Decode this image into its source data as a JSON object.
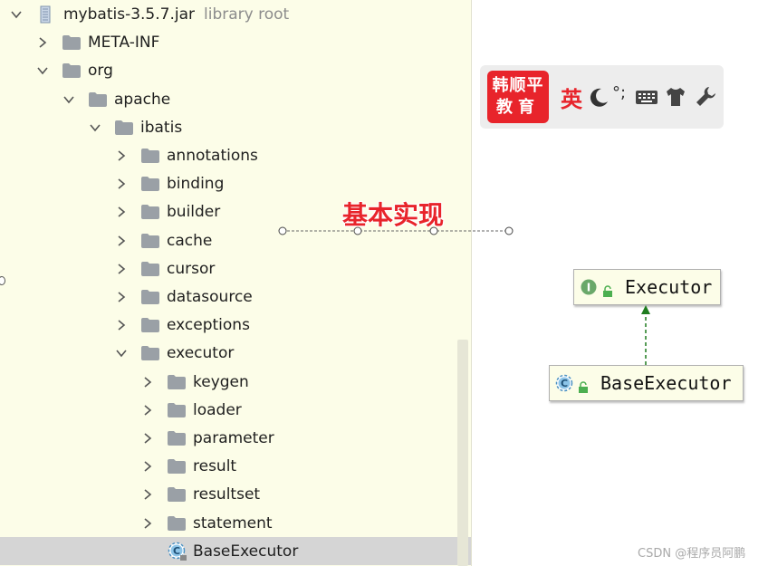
{
  "tree": {
    "root": {
      "name": "mybatis-3.5.7.jar",
      "note": "library root"
    },
    "items": [
      {
        "label": "META-INF",
        "state": "collapsed"
      },
      {
        "label": "org",
        "state": "expanded"
      },
      {
        "label": "apache",
        "state": "expanded"
      },
      {
        "label": "ibatis",
        "state": "expanded"
      },
      {
        "label": "annotations",
        "state": "collapsed"
      },
      {
        "label": "binding",
        "state": "collapsed"
      },
      {
        "label": "builder",
        "state": "collapsed"
      },
      {
        "label": "cache",
        "state": "collapsed"
      },
      {
        "label": "cursor",
        "state": "collapsed"
      },
      {
        "label": "datasource",
        "state": "collapsed"
      },
      {
        "label": "exceptions",
        "state": "collapsed"
      },
      {
        "label": "executor",
        "state": "expanded"
      },
      {
        "label": "keygen",
        "state": "collapsed"
      },
      {
        "label": "loader",
        "state": "collapsed"
      },
      {
        "label": "parameter",
        "state": "collapsed"
      },
      {
        "label": "result",
        "state": "collapsed"
      },
      {
        "label": "resultset",
        "state": "collapsed"
      },
      {
        "label": "statement",
        "state": "collapsed"
      },
      {
        "label": "BaseExecutor",
        "state": "selected-class"
      }
    ]
  },
  "ime": {
    "logo_line1": "韩顺平",
    "logo_line2": "教育",
    "lang": "英",
    "icons": [
      "moon-icon",
      "punctuation-icon",
      "keyboard-icon",
      "shirt-icon",
      "wrench-icon"
    ],
    "punctuation": "°;"
  },
  "annotation": {
    "text": "基本实现"
  },
  "uml": {
    "parent": {
      "name": "Executor",
      "kind": "interface"
    },
    "child": {
      "name": "BaseExecutor",
      "kind": "abstract-class"
    },
    "relation": "implements"
  },
  "watermark": "CSDN @程序员阿鹏",
  "colors": {
    "panel_bg": "#fcfde8",
    "selected_row": "#d5d5d5",
    "accent_red": "#e8242b",
    "arrow_green": "#1e7c1e",
    "folder_gray": "#9aa0a6"
  }
}
